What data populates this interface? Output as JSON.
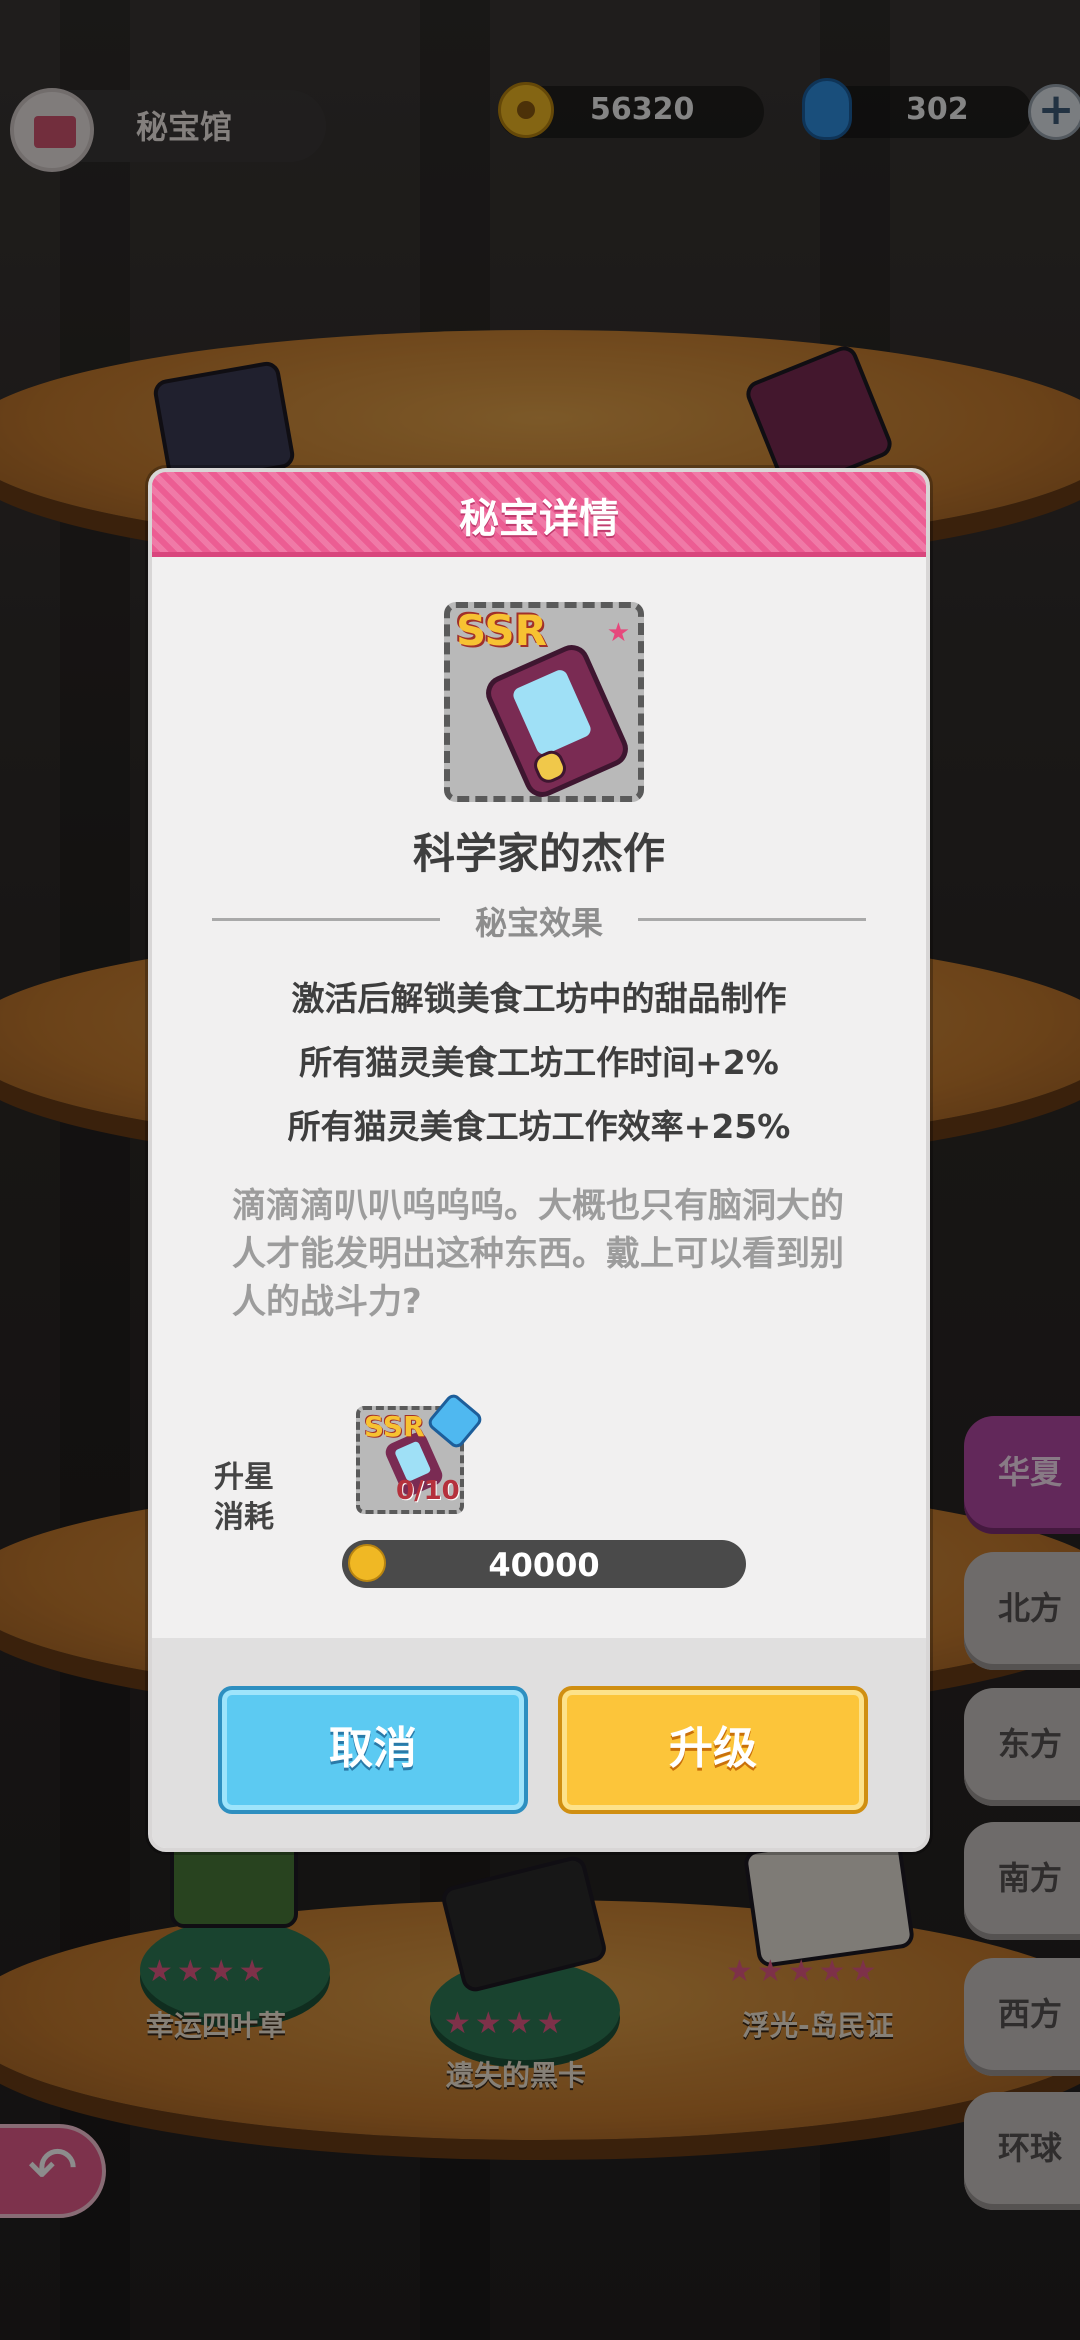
{
  "header": {
    "museum_title": "秘宝馆",
    "coins": "56320",
    "gems": "302",
    "plus": "+"
  },
  "regions": [
    "华夏",
    "北方",
    "东方",
    "南方",
    "西方",
    "环球"
  ],
  "active_region": "华夏",
  "shelf_items": [
    {
      "label": "幸运四叶草",
      "stars": "★★★★",
      "star_count": 4
    },
    {
      "label": "遗失的黑卡",
      "stars": "★★★★",
      "star_count": 4
    },
    {
      "label": "浮光-岛民证",
      "stars": "★★★★★",
      "star_count": 5
    }
  ],
  "dialog": {
    "title": "秘宝详情",
    "rarity": "SSR",
    "item_name": "科学家的杰作",
    "section_title": "秘宝效果",
    "effects": [
      "激活后解锁美食工坊中的甜品制作",
      "所有猫灵美食工坊工作时间+2%",
      "所有猫灵美食工坊工作效率+25%"
    ],
    "flavor_text": "滴滴滴叭叭呜呜呜。大概也只有脑洞大的人才能发明出这种东西。戴上可以看到别人的战斗力?",
    "cost_label_line1": "升星",
    "cost_label_line2": "消耗",
    "mini_rarity": "SSR",
    "material_count": "0/10",
    "price": "40000",
    "cancel_label": "取消",
    "upgrade_label": "升级"
  },
  "colors": {
    "header_pink": "#ec5d93",
    "cancel_blue": "#5ccaf2",
    "upgrade_yellow": "#fcc53a",
    "active_tab": "#b24aa4"
  }
}
